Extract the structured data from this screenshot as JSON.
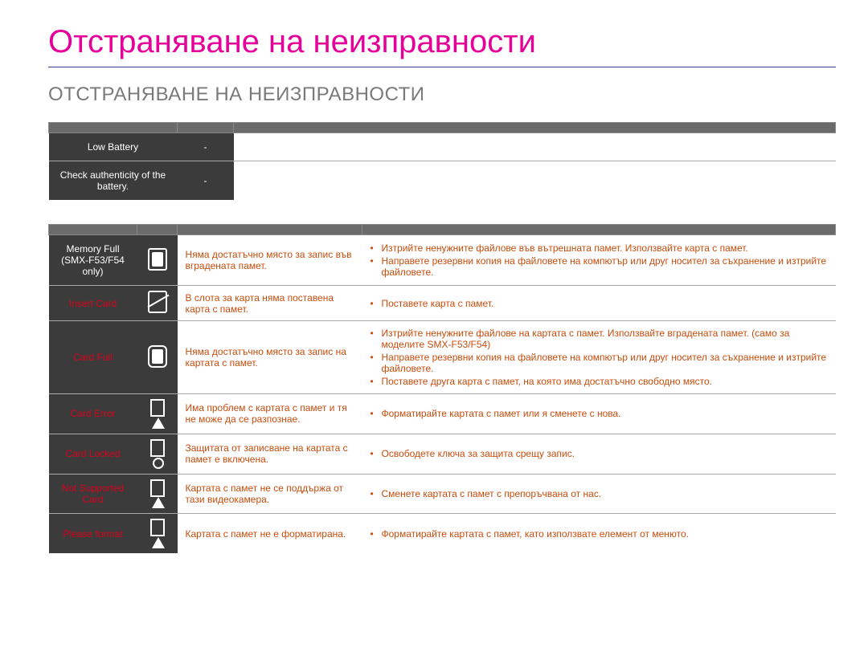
{
  "title": "Отстраняване на неизправности",
  "heading": "ОТСТРАНЯВАНЕ НА НЕИЗПРАВНОСТИ",
  "intro1": "",
  "intro2": "",
  "sub": "",
  "sub2": "",
  "table1": {
    "headers": [
      "",
      "",
      ""
    ],
    "rows": [
      {
        "msg": "Low Battery",
        "icon": "-",
        "action": ""
      },
      {
        "msg": "Check authenticity of the battery.",
        "icon": "-",
        "action": ""
      }
    ]
  },
  "table2": {
    "headers": [
      "",
      "",
      "",
      ""
    ],
    "rows": [
      {
        "msg": "Memory Full (SMX-F53/F54 only)",
        "msgClass": "plain",
        "icon": "sdfull",
        "desc": "Няма достатъчно място за запис във вградената памет.",
        "actions": [
          "Изтрийте ненужните файлове във вътрешната памет. Използвайте карта с памет.",
          "Направете резервни копия на файловете на компютър или друг носител за съхранение и изтрийте файловете."
        ]
      },
      {
        "msg": "Insert Card",
        "msgClass": "redtext",
        "icon": "sdslash",
        "desc": "В слота за карта няма поставена карта с памет.",
        "actions": [
          "Поставете карта с памет."
        ]
      },
      {
        "msg": "Card Full",
        "msgClass": "redtext",
        "icon": "sdfull2",
        "desc": "Няма достатъчно място за запис на картата с памет.",
        "actions": [
          "Изтрийте ненужните файлове на картата с памет. Използвайте вградената памет. (само за моделите SMX-F53/F54)",
          "Направете резервни копия на файловете на компютър или друг носител за съхранение и изтрийте файловете.",
          "Поставете друга карта с памет, на която има достатъчно свободно място."
        ]
      },
      {
        "msg": "Card Error",
        "msgClass": "redtext",
        "icon": "cardtri",
        "desc": "Има проблем с картата с памет и тя не може да се разпознае.",
        "actions": [
          "Форматирайте картата с памет или я сменете с нова."
        ]
      },
      {
        "msg": "Card Locked",
        "msgClass": "redtext",
        "icon": "cardlock",
        "desc": "Защитата от записване на картата с памет е включена.",
        "actions": [
          "Освободете ключа за защита срещу запис."
        ]
      },
      {
        "msg": "Not Supported Card",
        "msgClass": "redtext",
        "icon": "cardtri",
        "desc": "Картата с памет не се поддържа от тази видеокамера.",
        "actions": [
          "Сменете картата с памет с препоръчвана от нас."
        ]
      },
      {
        "msg": "Please format",
        "msgClass": "redtext",
        "icon": "cardtri",
        "desc": "Картата с памет не е форматирана.",
        "actions": [
          "Форматирайте картата с памет, като използвате елемент от менюто."
        ]
      }
    ]
  },
  "pagenum": ""
}
